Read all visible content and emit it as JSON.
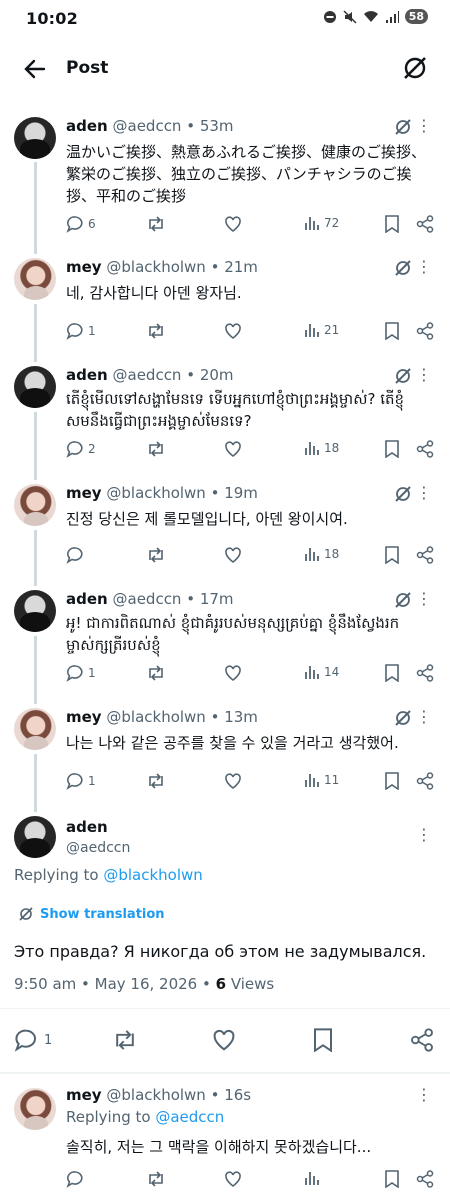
{
  "status": {
    "time": "10:02",
    "battery": "58"
  },
  "header": {
    "title": "Post"
  },
  "replies": [
    {
      "name": "aden",
      "handle": "@aedccn",
      "time": "53m",
      "text": "温かいご挨拶、熱意あふれるご挨拶、健康のご挨拶、繁栄のご挨拶、独立のご挨拶、パンチャシラのご挨拶、平和のご挨拶",
      "replies": "6",
      "retweets": "",
      "likes": "",
      "views": "72"
    },
    {
      "name": "mey",
      "handle": "@blackholwn",
      "time": "21m",
      "text": "네, 감사합니다 아덴 왕자님.",
      "replies": "1",
      "retweets": "",
      "likes": "",
      "views": "21"
    },
    {
      "name": "aden",
      "handle": "@aedccn",
      "time": "20m",
      "text": "តើខ្ញុំមើលទៅសង្ហាមែនទេ ទើបអ្នកហៅខ្ញុំថាព្រះអង្គម្ចាស់? តើខ្ញុំសមនឹងធ្វើជាព្រះអង្គម្ចាស់មែនទេ?",
      "replies": "2",
      "retweets": "",
      "likes": "",
      "views": "18"
    },
    {
      "name": "mey",
      "handle": "@blackholwn",
      "time": "19m",
      "text": "진정 당신은 제 롤모델입니다, 아덴 왕이시여.",
      "replies": "",
      "retweets": "",
      "likes": "",
      "views": "18"
    },
    {
      "name": "aden",
      "handle": "@aedccn",
      "time": "17m",
      "text": "អូ! ជាការពិតណាស់ ខ្ញុំជាគំរូរបស់មនុស្សគ្រប់គ្នា ខ្ញុំនឹងស្វែងរកម្ចាស់ក្សត្រីរបស់ខ្ញុំ",
      "replies": "1",
      "retweets": "",
      "likes": "",
      "views": "14"
    },
    {
      "name": "mey",
      "handle": "@blackholwn",
      "time": "13m",
      "text": "나는 나와 같은 공주를 찾을 수 있을 거라고 생각했어.",
      "replies": "1",
      "retweets": "",
      "likes": "",
      "views": "11"
    }
  ],
  "focus": {
    "name": "aden",
    "handle": "@aedccn",
    "replying_prefix": "Replying to ",
    "replying_to": "@blackholwn",
    "show_translation": "Show translation",
    "text": "Это правда? Я никогда об этом не задумывался.",
    "timestamp": "9:50 am • May 16, 2026 • ",
    "views_count": "6",
    "views_label": " Views",
    "reply_count": "1"
  },
  "bottom_reply": {
    "name": "mey",
    "handle": "@blackholwn",
    "time": "16s",
    "replying_prefix": "Replying to ",
    "replying_to": "@aedccn",
    "text": "솔직히, 저는 그 맥락을 이해하지 못하겠습니다..."
  },
  "colors": {
    "accent": "#1d9bf0",
    "muted": "#536471",
    "line": "#cfd9de"
  }
}
